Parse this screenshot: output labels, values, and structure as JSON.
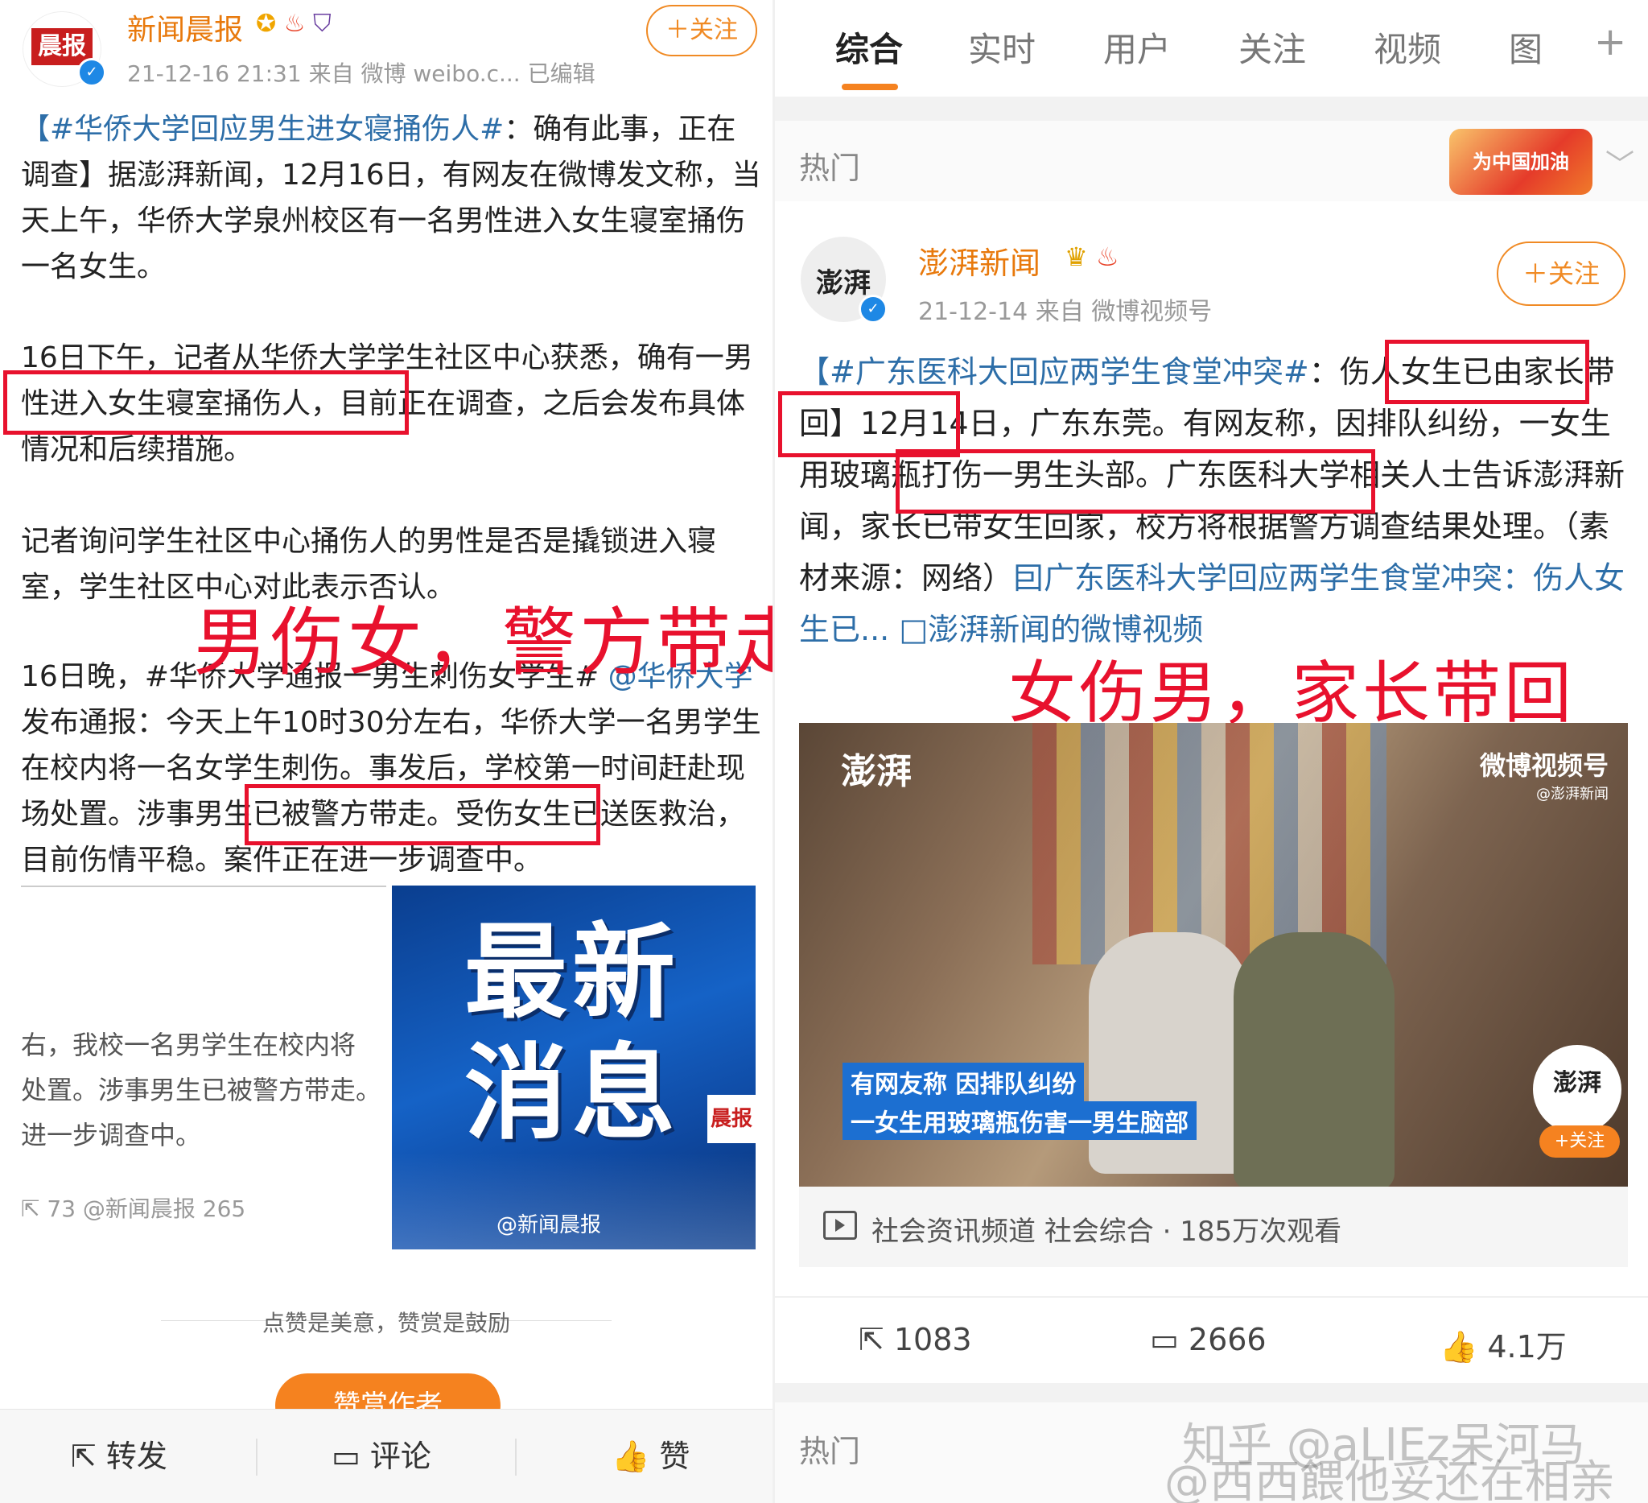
{
  "left": {
    "account": {
      "name": "新闻晨报",
      "meta": "21-12-16 21:31   来自 微博 weibo.c...   已编辑",
      "follow": "＋关注",
      "verified": "✓",
      "avatar_text": "晨报"
    },
    "para1": {
      "topic": "【#华侨大学回应男生进女寝捅伤人#",
      "rest": "：确有此事，正在调查】据澎湃新闻，12月16日，有网友在微博发文称，当天上午，华侨大学泉州校区有一名男性进入女生寝室捅伤一名女生。"
    },
    "para2": "16日下午，记者从华侨大学学生社区中心获悉，确有一男性进入女生寝室捅伤人，目前正在调查，之后会发布具体情况和后续措施。",
    "para3": "记者询问学生社区中心捅伤人的男性是否是撬锁进入寝室，学生社区中心对此表示否认。",
    "para4": {
      "part1": "16日晚，#华侨大学通报一男生刺伤女学生# ",
      "mention": "@华侨大学",
      "part2": " 发布通报：今天上午10时30分左右，华侨大学一名男学生在校内将一名女学生刺伤。事发后，学校第一时间赶赴现场处置。涉事男生已被警方带走。受伤女生已送医救治，目前伤情平稳。案件正在进一步调查中。"
    },
    "annotation": "男伤女，警方带走",
    "crop_text": [
      "右，我校一名男学生在校内将",
      "处置。涉事男生已被警方带走。",
      "进一步调查中。"
    ],
    "crop_stats": "73  @新闻晨报  265",
    "news_image": {
      "title_line1": "最新",
      "title_line2": "消息",
      "watermark": "@新闻晨报",
      "logo": "晨报"
    },
    "praise_text": "点赞是美意，赞赏是鼓励",
    "reward_button": "赞赏作者",
    "bottom_bar": {
      "repost": "转发",
      "comment": "评论",
      "like": "赞"
    }
  },
  "right": {
    "tabs": [
      "综合",
      "实时",
      "用户",
      "关注",
      "视频",
      "图",
      "+"
    ],
    "hot_label": "热门",
    "china_badge": "为中国加油",
    "account": {
      "name": "澎湃新闻",
      "meta": "21-12-14  来自 微博视频号",
      "follow": "＋关注",
      "verified": "✓",
      "avatar_text": "澎湃"
    },
    "body": {
      "topic": "【#广东医科大回应两学生食堂冲突#",
      "colon": "：",
      "boxed1": "伤人女生已由家长带回】",
      "text1": "12月14日，广东东莞。有网友称，因排队纠纷，",
      "boxed2": "一女生用玻璃瓶打伤一男生头部。",
      "text2": "广东医科大学相关人士告诉澎湃新闻，家长已带女生回家，校方将根据警方调查结果处理。（素材来源：网络）",
      "link1": "囙广东医科大学回应两学生食堂冲突：伤人女生已...",
      "link2": "□澎湃新闻的微博视频"
    },
    "annotation": "女伤男，家长带回",
    "video": {
      "logo": "澎湃",
      "watermark": "微博视频号",
      "watermark_sub": "@澎湃新闻",
      "caption1": "有网友称 因排队纠纷",
      "caption2": "一女生用玻璃瓶伤害一男生脑部",
      "corner_logo": "澎湃",
      "corner_follow": "+关注"
    },
    "video_info": "社会资讯频道 社会综合 · 185万次观看",
    "stats": {
      "repost": "1083",
      "comment": "2666",
      "like": "4.1万"
    },
    "hot_label2": "热门",
    "watermark1": "知乎 @aLIEz呆河马",
    "watermark2": "@西西餵他妥还在相亲"
  }
}
